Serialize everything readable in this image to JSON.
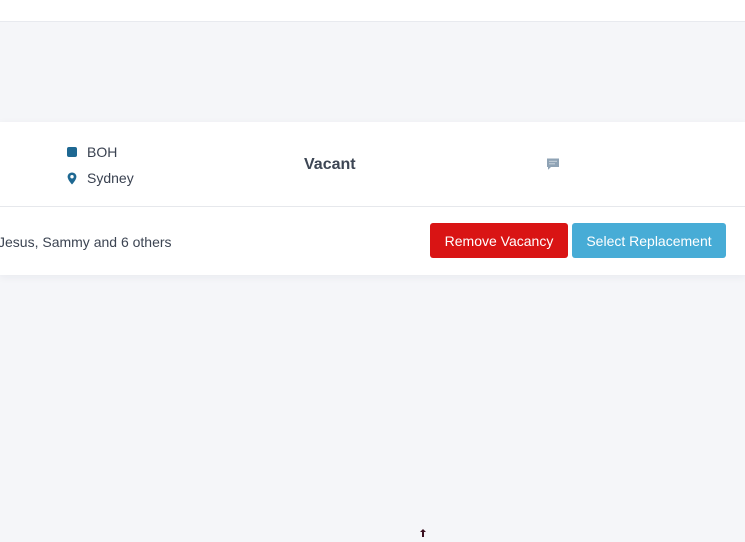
{
  "shift_card": {
    "department": "BOH",
    "location": "Sydney",
    "status": "Vacant",
    "assignees_summary": "Jesus, Sammy and 6 others",
    "remove_button_label": "Remove Vacancy",
    "select_button_label": "Select Replacement"
  },
  "icons": {
    "department": "square-icon",
    "location": "map-pin-icon",
    "comment": "comment-icon",
    "cursor": "move-cursor-icon"
  },
  "colors": {
    "page_background": "#f5f6f9",
    "department_icon": "#1e6892",
    "remove_button": "#d91414",
    "select_button": "#47acd6",
    "comment_icon": "#8fa3b5"
  }
}
